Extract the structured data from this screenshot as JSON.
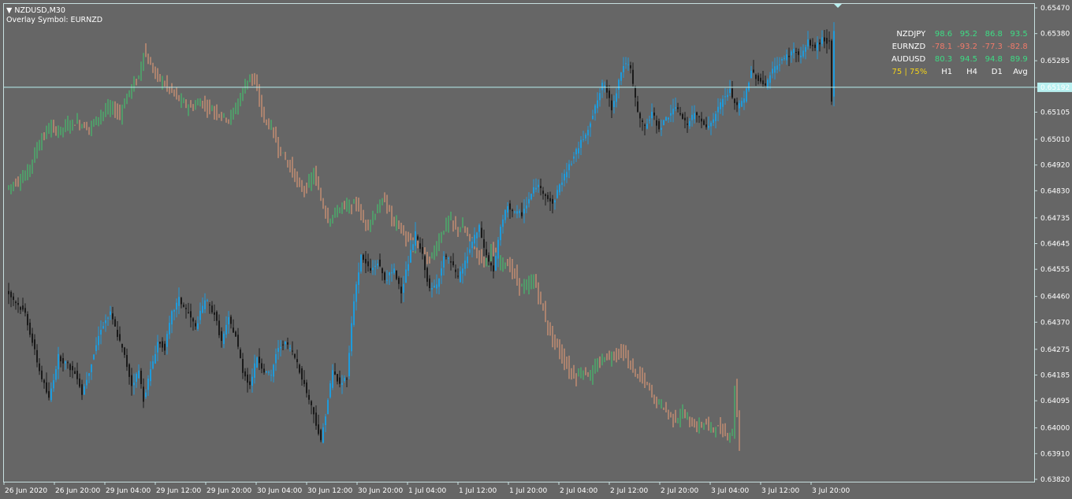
{
  "header": {
    "symbol_label": "NZDUSD,M30",
    "overlay_label": "Overlay Symbol: EURNZD"
  },
  "colors": {
    "background": "#666666",
    "bull_candle": "#1e9bdc",
    "bear_candle": "#1a1a1a",
    "overlay_up": "#3ecf6e",
    "overlay_down": "#f0a078",
    "price_line": "#b8f0f0",
    "axis": "#c8e0e0",
    "strength_positive": "#3ddc84",
    "strength_negative": "#f07a6a",
    "strength_score": "#f2d21a"
  },
  "chart_data": {
    "type": "candlestick",
    "main_symbol": "NZDUSD",
    "timeframe": "M30",
    "overlay_symbol": "EURNZD",
    "ylim": [
      0.6382,
      0.6547
    ],
    "y_ticks": [
      "0.65470",
      "0.65380",
      "0.65285",
      "0.65192",
      "0.65105",
      "0.65010",
      "0.64920",
      "0.64830",
      "0.64735",
      "0.64645",
      "0.64555",
      "0.64460",
      "0.64370",
      "0.64275",
      "0.64185",
      "0.64095",
      "0.64000",
      "0.63910",
      "0.63820"
    ],
    "current_price": "0.65192",
    "x_ticks": [
      "26 Jun 2020",
      "26 Jun 20:00",
      "29 Jun 04:00",
      "29 Jun 12:00",
      "29 Jun 20:00",
      "30 Jun 04:00",
      "30 Jun 12:00",
      "30 Jun 20:00",
      "1 Jul 04:00",
      "1 Jul 12:00",
      "1 Jul 20:00",
      "2 Jul 04:00",
      "2 Jul 12:00",
      "2 Jul 20:00",
      "3 Jul 04:00",
      "3 Jul 12:00",
      "3 Jul 20:00"
    ],
    "grid": false,
    "main_path": [
      [
        0,
        0.6448
      ],
      [
        8,
        0.644
      ],
      [
        14,
        0.642
      ],
      [
        18,
        0.641
      ],
      [
        22,
        0.6425
      ],
      [
        26,
        0.6422
      ],
      [
        30,
        0.6418
      ],
      [
        32,
        0.6412
      ],
      [
        35,
        0.642
      ],
      [
        40,
        0.6435
      ],
      [
        44,
        0.644
      ],
      [
        48,
        0.643
      ],
      [
        50,
        0.6425
      ],
      [
        53,
        0.6415
      ],
      [
        56,
        0.642
      ],
      [
        58,
        0.641
      ],
      [
        61,
        0.642
      ],
      [
        64,
        0.643
      ],
      [
        67,
        0.6428
      ],
      [
        70,
        0.644
      ],
      [
        73,
        0.6445
      ],
      [
        77,
        0.644
      ],
      [
        80,
        0.6435
      ],
      [
        84,
        0.6445
      ],
      [
        88,
        0.644
      ],
      [
        91,
        0.643
      ],
      [
        94,
        0.6438
      ],
      [
        97,
        0.6432
      ],
      [
        100,
        0.642
      ],
      [
        103,
        0.6415
      ],
      [
        106,
        0.6425
      ],
      [
        109,
        0.642
      ],
      [
        112,
        0.6418
      ],
      [
        114,
        0.6426
      ],
      [
        117,
        0.643
      ],
      [
        120,
        0.6428
      ],
      [
        123,
        0.6423
      ],
      [
        126,
        0.6415
      ],
      [
        130,
        0.6405
      ],
      [
        133,
        0.6395
      ],
      [
        136,
        0.641
      ],
      [
        138,
        0.642
      ],
      [
        141,
        0.6415
      ],
      [
        144,
        0.6418
      ],
      [
        147,
        0.6445
      ],
      [
        150,
        0.646
      ],
      [
        154,
        0.6455
      ],
      [
        157,
        0.6458
      ],
      [
        160,
        0.6452
      ],
      [
        164,
        0.6455
      ],
      [
        167,
        0.6448
      ],
      [
        170,
        0.6458
      ],
      [
        173,
        0.6468
      ],
      [
        176,
        0.646
      ],
      [
        179,
        0.6448
      ],
      [
        182,
        0.645
      ],
      [
        185,
        0.646
      ],
      [
        188,
        0.6458
      ],
      [
        191,
        0.6452
      ],
      [
        194,
        0.6458
      ],
      [
        197,
        0.6465
      ],
      [
        200,
        0.647
      ],
      [
        203,
        0.646
      ],
      [
        206,
        0.6455
      ],
      [
        209,
        0.647
      ],
      [
        212,
        0.6478
      ],
      [
        215,
        0.6475
      ],
      [
        218,
        0.6475
      ],
      [
        221,
        0.648
      ],
      [
        224,
        0.6485
      ],
      [
        228,
        0.6482
      ],
      [
        231,
        0.6478
      ],
      [
        234,
        0.6485
      ],
      [
        237,
        0.649
      ],
      [
        240,
        0.6495
      ],
      [
        243,
        0.65
      ],
      [
        246,
        0.6505
      ],
      [
        249,
        0.6512
      ],
      [
        252,
        0.652
      ],
      [
        254,
        0.6518
      ],
      [
        256,
        0.6512
      ],
      [
        258,
        0.6518
      ],
      [
        260,
        0.6525
      ],
      [
        262,
        0.6528
      ],
      [
        264,
        0.6525
      ],
      [
        267,
        0.651
      ],
      [
        270,
        0.6505
      ],
      [
        273,
        0.651
      ],
      [
        276,
        0.6505
      ],
      [
        279,
        0.6508
      ],
      [
        282,
        0.6512
      ],
      [
        285,
        0.651
      ],
      [
        288,
        0.6506
      ],
      [
        291,
        0.651
      ],
      [
        294,
        0.6508
      ],
      [
        297,
        0.6505
      ],
      [
        300,
        0.651
      ],
      [
        303,
        0.6515
      ],
      [
        306,
        0.6518
      ],
      [
        309,
        0.6512
      ],
      [
        312,
        0.6515
      ],
      [
        315,
        0.6525
      ],
      [
        318,
        0.6522
      ],
      [
        321,
        0.652
      ],
      [
        324,
        0.6525
      ],
      [
        327,
        0.6528
      ],
      [
        330,
        0.653
      ],
      [
        333,
        0.6532
      ],
      [
        336,
        0.653
      ],
      [
        339,
        0.6535
      ],
      [
        342,
        0.6533
      ],
      [
        345,
        0.6536
      ],
      [
        348,
        0.6535
      ],
      [
        349,
        0.6515
      ],
      [
        350,
        0.6538
      ]
    ],
    "overlay_path": [
      [
        0,
        0.6484
      ],
      [
        8,
        0.6488
      ],
      [
        14,
        0.65
      ],
      [
        18,
        0.6505
      ],
      [
        22,
        0.6504
      ],
      [
        26,
        0.6506
      ],
      [
        30,
        0.6507
      ],
      [
        32,
        0.6506
      ],
      [
        35,
        0.6505
      ],
      [
        40,
        0.651
      ],
      [
        44,
        0.6512
      ],
      [
        48,
        0.651
      ],
      [
        52,
        0.6518
      ],
      [
        56,
        0.6523
      ],
      [
        58,
        0.6532
      ],
      [
        60,
        0.6528
      ],
      [
        63,
        0.6524
      ],
      [
        66,
        0.6521
      ],
      [
        70,
        0.6518
      ],
      [
        74,
        0.6514
      ],
      [
        78,
        0.6512
      ],
      [
        82,
        0.6514
      ],
      [
        86,
        0.6512
      ],
      [
        90,
        0.651
      ],
      [
        94,
        0.6508
      ],
      [
        97,
        0.6512
      ],
      [
        100,
        0.6518
      ],
      [
        103,
        0.6524
      ],
      [
        106,
        0.6518
      ],
      [
        109,
        0.6508
      ],
      [
        112,
        0.6505
      ],
      [
        115,
        0.6498
      ],
      [
        118,
        0.6494
      ],
      [
        121,
        0.649
      ],
      [
        124,
        0.6484
      ],
      [
        127,
        0.6484
      ],
      [
        130,
        0.6489
      ],
      [
        133,
        0.648
      ],
      [
        136,
        0.6473
      ],
      [
        139,
        0.6475
      ],
      [
        142,
        0.6478
      ],
      [
        145,
        0.6477
      ],
      [
        148,
        0.6479
      ],
      [
        151,
        0.6472
      ],
      [
        154,
        0.6472
      ],
      [
        157,
        0.6477
      ],
      [
        160,
        0.648
      ],
      [
        163,
        0.6473
      ],
      [
        166,
        0.6471
      ],
      [
        169,
        0.6466
      ],
      [
        172,
        0.6463
      ],
      [
        175,
        0.6465
      ],
      [
        178,
        0.6458
      ],
      [
        181,
        0.6462
      ],
      [
        184,
        0.6468
      ],
      [
        187,
        0.6473
      ],
      [
        190,
        0.647
      ],
      [
        193,
        0.647
      ],
      [
        196,
        0.6466
      ],
      [
        199,
        0.6462
      ],
      [
        202,
        0.6458
      ],
      [
        205,
        0.6462
      ],
      [
        208,
        0.6458
      ],
      [
        211,
        0.6458
      ],
      [
        214,
        0.6455
      ],
      [
        217,
        0.645
      ],
      [
        220,
        0.6449
      ],
      [
        223,
        0.6452
      ],
      [
        226,
        0.6444
      ],
      [
        229,
        0.6435
      ],
      [
        232,
        0.643
      ],
      [
        235,
        0.6425
      ],
      [
        238,
        0.642
      ],
      [
        241,
        0.6418
      ],
      [
        244,
        0.642
      ],
      [
        247,
        0.6418
      ],
      [
        250,
        0.6422
      ],
      [
        253,
        0.6425
      ],
      [
        256,
        0.6425
      ],
      [
        259,
        0.6427
      ],
      [
        262,
        0.6425
      ],
      [
        265,
        0.642
      ],
      [
        268,
        0.6418
      ],
      [
        271,
        0.6415
      ],
      [
        274,
        0.641
      ],
      [
        277,
        0.6408
      ],
      [
        280,
        0.6405
      ],
      [
        283,
        0.6403
      ],
      [
        286,
        0.6405
      ],
      [
        289,
        0.6402
      ],
      [
        292,
        0.64
      ],
      [
        295,
        0.6402
      ],
      [
        298,
        0.64
      ],
      [
        301,
        0.64
      ],
      [
        304,
        0.6398
      ],
      [
        307,
        0.6398
      ],
      [
        308,
        0.6415
      ],
      [
        310,
        0.6394
      ]
    ],
    "currency_strength": {
      "columns": [
        "H1",
        "H4",
        "D1",
        "Avg"
      ],
      "rows": [
        {
          "symbol": "NZDJPY",
          "values": [
            "98.6",
            "95.2",
            "86.8",
            "93.5"
          ]
        },
        {
          "symbol": "EURNZD",
          "values": [
            "-78.1",
            "-93.2",
            "-77.3",
            "-82.8"
          ]
        },
        {
          "symbol": "AUDUSD",
          "values": [
            "80.3",
            "94.5",
            "94.8",
            "89.9"
          ]
        }
      ],
      "score_label": "75 | 75%"
    }
  }
}
